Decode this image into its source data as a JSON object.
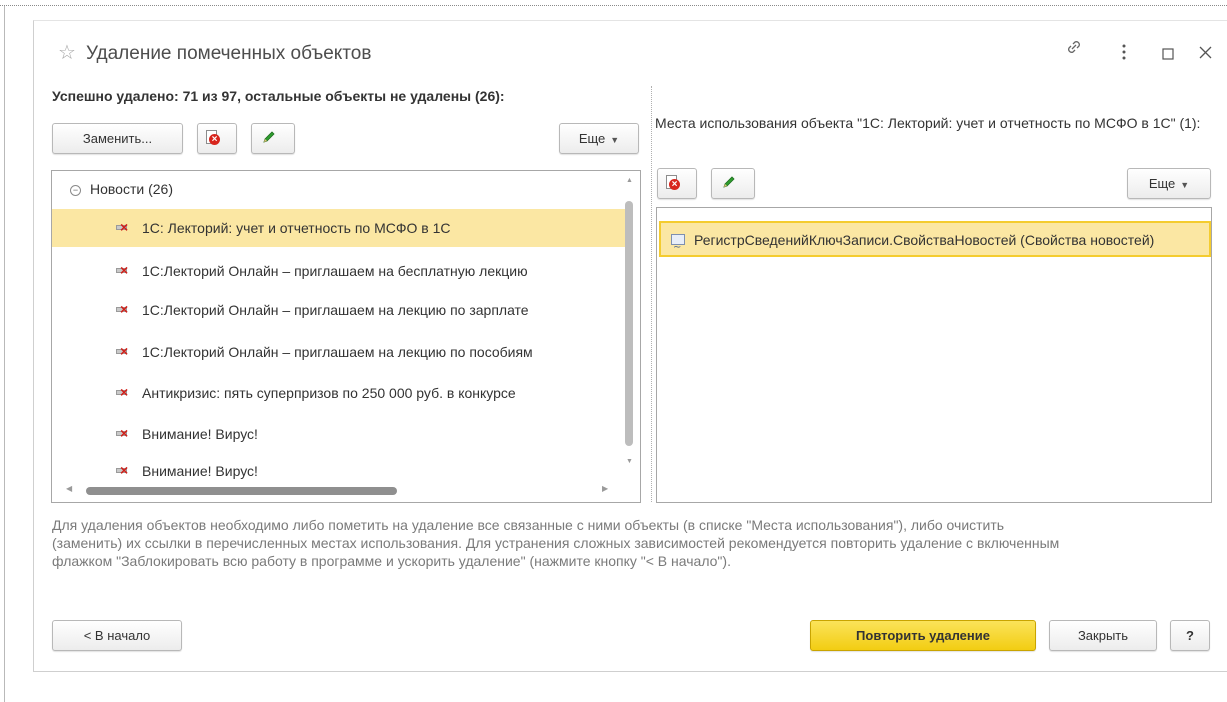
{
  "window": {
    "title": "Удаление помеченных объектов",
    "controls": {
      "link_icon": "link-icon",
      "more_icon": "more-vertical-icon",
      "maximize_icon": "maximize-icon",
      "close_icon": "close-icon"
    }
  },
  "status_text": "Успешно удалено: 71 из 97, остальные объекты не удалены (26):",
  "left_toolbar": {
    "replace_label": "Заменить...",
    "delete_icon": "delete-mark-icon",
    "edit_icon": "pencil-icon",
    "more_label": "Еще"
  },
  "tree": {
    "group": {
      "label": "Новости (26)"
    },
    "items": [
      {
        "label": "1С: Лекторий: учет и отчетность по МСФО в 1С",
        "selected": true
      },
      {
        "label": "1С:Лекторий Онлайн – приглашаем на бесплатную лекцию"
      },
      {
        "label": "1С:Лекторий Онлайн – приглашаем на лекцию по зарплате"
      },
      {
        "label": "1С:Лекторий Онлайн – приглашаем на лекцию по пособиям"
      },
      {
        "label": "Антикризис: пять суперпризов по 250 000 руб. в конкурсе"
      },
      {
        "label": "Внимание! Вирус!"
      },
      {
        "label": "Внимание! Вирус!"
      }
    ]
  },
  "usage": {
    "heading": "Места использования объекта \"1С: Лекторий: учет и отчетность по МСФО в 1С\" (1):",
    "toolbar": {
      "delete_icon": "delete-mark-icon",
      "edit_icon": "pencil-icon",
      "more_label": "Еще"
    },
    "items": [
      {
        "label": "РегистрСведенийКлючЗаписи.СвойстваНовостей (Свойства новостей)",
        "selected": true
      }
    ]
  },
  "hint": "Для удаления объектов необходимо либо пометить на удаление все связанные с ними объекты (в списке \"Места использования\"), либо очистить (заменить) их ссылки в перечисленных местах использования. Для устранения сложных зависимостей рекомендуется повторить удаление с включенным флажком \"Заблокировать всю работу в программе и ускорить удаление\" (нажмите кнопку \"< В начало\").",
  "footer": {
    "back_label": "< В начало",
    "retry_label": "Повторить удаление",
    "close_label": "Закрыть",
    "help_label": "?"
  },
  "colors": {
    "accent_yellow": "#f4cc2f",
    "selection": "#fbe7a3",
    "delete_red": "#d8251d"
  }
}
